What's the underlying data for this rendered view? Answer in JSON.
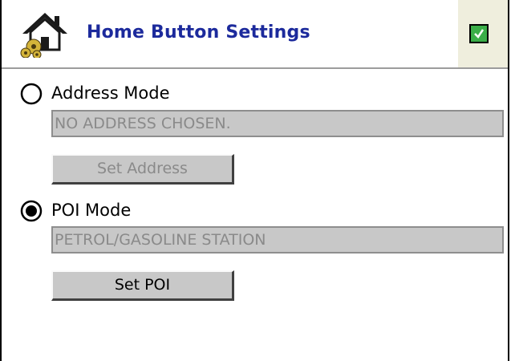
{
  "header": {
    "title": "Home Button Settings",
    "icon": "home-settings-icon",
    "ok_icon": "checkmark-icon",
    "colors": {
      "title": "#1c2a9c",
      "ok_bg": "#3bae48",
      "ok_area": "#efeedd"
    }
  },
  "address_mode": {
    "label": "Address Mode",
    "selected": false,
    "field_value": "NO ADDRESS CHOSEN.",
    "button_label": "Set Address",
    "button_enabled": false
  },
  "poi_mode": {
    "label": "POI Mode",
    "selected": true,
    "field_value": "PETROL/GASOLINE STATION",
    "button_label": "Set POI",
    "button_enabled": true
  }
}
